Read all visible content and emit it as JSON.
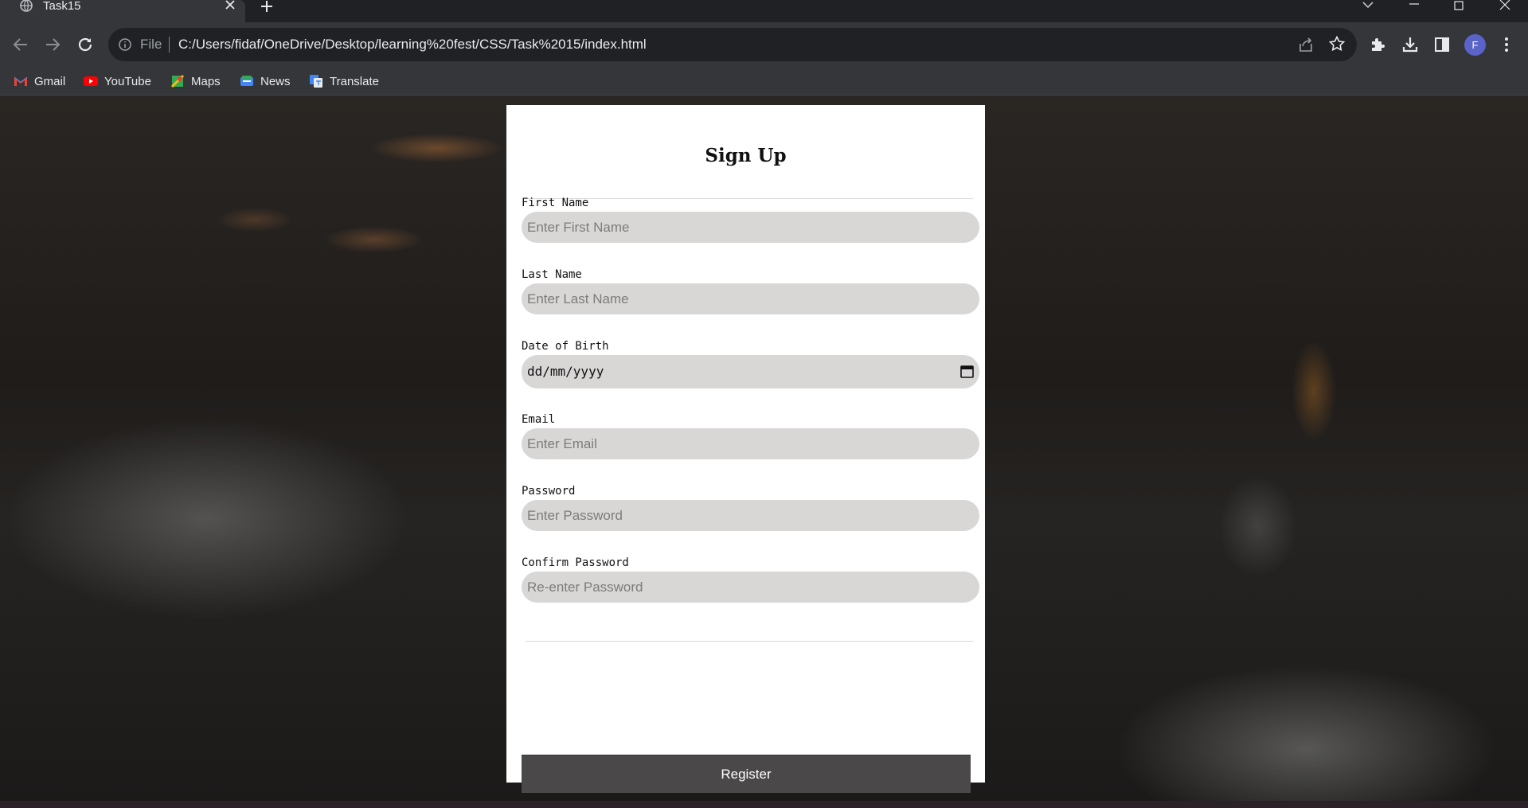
{
  "browser": {
    "tab_title": "Task15",
    "url_scheme_label": "File",
    "url": "C:/Users/fidaf/OneDrive/Desktop/learning%20fest/CSS/Task%2015/index.html",
    "profile_initial": "F",
    "accent_color": "#5a63c8"
  },
  "bookmarks": [
    {
      "label": "Gmail",
      "icon": "gmail-icon"
    },
    {
      "label": "YouTube",
      "icon": "youtube-icon"
    },
    {
      "label": "Maps",
      "icon": "maps-icon"
    },
    {
      "label": "News",
      "icon": "news-icon"
    },
    {
      "label": "Translate",
      "icon": "translate-icon"
    }
  ],
  "form": {
    "title": "Sign Up",
    "fields": [
      {
        "label": "First Name",
        "placeholder": "Enter First Name"
      },
      {
        "label": "Last Name",
        "placeholder": "Enter Last Name"
      },
      {
        "label": "Date of Birth",
        "value": "dd/mm/yyyy"
      },
      {
        "label": "Email",
        "placeholder": "Enter Email"
      },
      {
        "label": "Password",
        "placeholder": "Enter Password"
      },
      {
        "label": "Confirm Password",
        "placeholder": "Re-enter Password"
      }
    ],
    "submit_label": "Register"
  }
}
